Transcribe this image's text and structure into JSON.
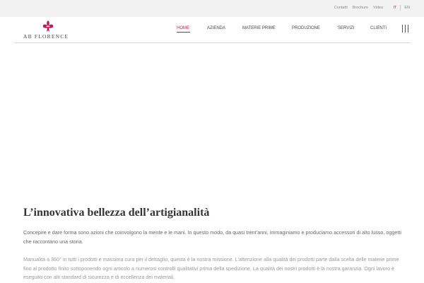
{
  "topbar": {
    "links": [
      "Contatti",
      "Brochure",
      "Video"
    ],
    "lang_it": "IT",
    "lang_en": "EN"
  },
  "logo": {
    "text": "AB  FLORENCE",
    "icon": "fleur-de-lis-icon"
  },
  "nav": {
    "items": [
      "HOME",
      "AZIENDA",
      "MATERIE PRIME",
      "PRODUZIONE",
      "SERVIZI",
      "CLIENTI"
    ],
    "active": "HOME",
    "menu_icon": "menu-icon"
  },
  "colors": {
    "accent": "#c2185b",
    "topbar_bg": "#f2f2f2"
  },
  "main": {
    "title": "L’innovativa bellezza dell’artigianalità",
    "paragraph1": "Concepire e dare forma sono azioni che coinvolgono la mente e le mani. In questo modo, da quasi trent’anni, immaginiamo e produciamo accessori di alto lusso, oggetti che raccontano una storia.",
    "paragraph2": "Manualità a 360° in tutti i prodotti e massima cura per il dettaglio, questa è la nostra missione. L’attenzione alla qualità dei prodotti parte dalla scelta delle materie prime fino al prodotto finito sottoponendo ogni articolo a numerosi controlli qualitativi prima della spedizione. La qualità dei nostri prodotti è la nostra garanzia. Ogni lavoro è eseguito con alti standard di sicurezza e di eccellenza dei materiali."
  }
}
